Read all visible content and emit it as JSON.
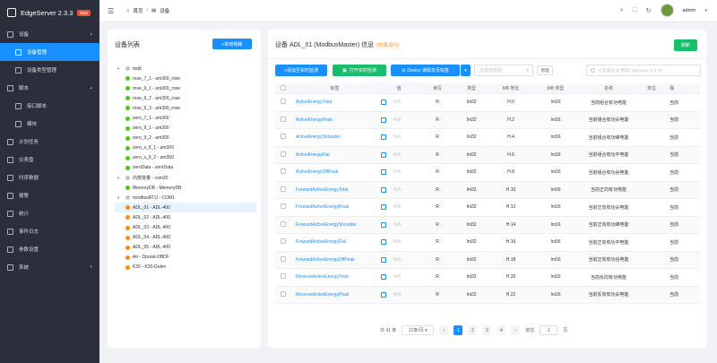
{
  "app": {
    "name": "EdgeServer 2.3.3",
    "badge": "beta"
  },
  "sidebar": {
    "items": [
      {
        "label": "设备",
        "icon": "device-icon",
        "expanded": true
      },
      {
        "label": "设备管理",
        "icon": "device-manage-icon",
        "sub": true,
        "active": true
      },
      {
        "label": "设备类型管理",
        "icon": "device-type-icon",
        "sub": true
      },
      {
        "label": "脚本",
        "icon": "script-icon",
        "expanded": true
      },
      {
        "label": "接口脚本",
        "icon": "interface-script-icon",
        "sub": true
      },
      {
        "label": "模块",
        "icon": "module-icon",
        "sub": true
      },
      {
        "label": "计划任务",
        "icon": "schedule-icon"
      },
      {
        "label": "仪表盘",
        "icon": "dashboard-icon"
      },
      {
        "label": "时序数据",
        "icon": "timeseries-icon"
      },
      {
        "label": "报警",
        "icon": "alarm-icon"
      },
      {
        "label": "统计",
        "icon": "stats-icon"
      },
      {
        "label": "事件日志",
        "icon": "event-log-icon"
      },
      {
        "label": "参数设置",
        "icon": "settings-icon"
      },
      {
        "label": "系统",
        "icon": "system-icon",
        "expandable": true
      }
    ]
  },
  "header": {
    "breadcrumb": [
      "首页",
      "设备"
    ],
    "user": "admin"
  },
  "left_panel": {
    "title": "设备列表",
    "add_button": "+新增链路",
    "tree": [
      {
        "label": "mqtt",
        "level": 0,
        "dot": "gr",
        "caret": "▾"
      },
      {
        "label": "rose_7_1 - am300_rose",
        "level": 1,
        "dot": "g"
      },
      {
        "label": "rose_9_1 - am300_rose",
        "level": 1,
        "dot": "g"
      },
      {
        "label": "rose_9_2 - am300_rose",
        "level": 1,
        "dot": "g"
      },
      {
        "label": "rose_9_3 - am300_rose",
        "level": 1,
        "dot": "g"
      },
      {
        "label": "zero_7_1 - am300",
        "level": 1,
        "dot": "g"
      },
      {
        "label": "zero_9_1 - am300",
        "level": 1,
        "dot": "g"
      },
      {
        "label": "zero_9_2 - am300",
        "level": 1,
        "dot": "g"
      },
      {
        "label": "zero_s_9_1 - am300",
        "level": 1,
        "dot": "g"
      },
      {
        "label": "zero_s_9_2 - am300",
        "level": 1,
        "dot": "g"
      },
      {
        "label": "zeroData - zeroData",
        "level": 1,
        "dot": "g"
      },
      {
        "label": "内部变量 - com20",
        "level": 0,
        "dot": "gr",
        "caret": "▾"
      },
      {
        "label": "MemoryDB - MemoryDB",
        "level": 1,
        "dot": "g"
      },
      {
        "label": "modbusRTU - COM1",
        "level": 0,
        "dot": "gr",
        "caret": "▾"
      },
      {
        "label": "ADL_01 - ADL-400",
        "level": 1,
        "dot": "o",
        "selected": true
      },
      {
        "label": "ADL_02 - ADL-400",
        "level": 1,
        "dot": "o"
      },
      {
        "label": "ADL_03 - ADL-400",
        "level": 1,
        "dot": "o"
      },
      {
        "label": "ADL_04 - ADL-400",
        "level": 1,
        "dot": "o"
      },
      {
        "label": "ADL_05 - ADL-400",
        "level": 1,
        "dot": "o"
      },
      {
        "label": "Air - Dpurat-DBDF",
        "level": 1,
        "dot": "o"
      },
      {
        "label": "K30 - K30-Golen",
        "level": 1,
        "dot": "o"
      }
    ]
  },
  "main": {
    "title": "设备 ADL_01 (ModbusMaster) 信息",
    "status": "(仿真运行)",
    "refresh": "刷新",
    "toolbar": {
      "add_monitor": "+添加至实时监测",
      "open_monitor": "打开实时检测",
      "read_tags": "从 Device 读取本页标签",
      "dropdown": "▾",
      "select_placeholder": "选择标签组",
      "manage": "管理",
      "search_placeholder": "过滤表达式 例如: tagName 0.4-20"
    },
    "columns": [
      "",
      "标签",
      "值",
      "读写",
      "类型",
      "MB 地址",
      "MB 类型",
      "名称",
      "单位",
      "描"
    ],
    "rows": [
      {
        "tag": "ActiveEnergyTotal",
        "value": "N/A",
        "rw": "R",
        "type": "Int32",
        "addr": "H.0",
        "mbtype": "Int16",
        "name": "当前组合有功电能",
        "desc": "当前"
      },
      {
        "tag": "ActiveEnergyPeak",
        "value": "N/A",
        "rw": "R",
        "type": "Int32",
        "addr": "H.2",
        "mbtype": "Int16",
        "name": "当前组合有功尖电能",
        "desc": "当前"
      },
      {
        "tag": "ActiveEnergyShoulder",
        "value": "N/A",
        "rw": "R",
        "type": "Int32",
        "addr": "H.4",
        "mbtype": "Int16",
        "name": "当前组合有功峰电能",
        "desc": "当前"
      },
      {
        "tag": "ActiveEnergyFlat",
        "value": "N/A",
        "rw": "R",
        "type": "Int32",
        "addr": "H.6",
        "mbtype": "Int16",
        "name": "当前组合有功平电能",
        "desc": "当前"
      },
      {
        "tag": "ActiveEnergyOffPeak",
        "value": "N/A",
        "rw": "R",
        "type": "Int32",
        "addr": "H.8",
        "mbtype": "Int16",
        "name": "当前组合有功谷电能",
        "desc": "当前"
      },
      {
        "tag": "ForwardActiveEnergyTotal",
        "value": "N/A",
        "rw": "R",
        "type": "Int32",
        "addr": "H.10",
        "mbtype": "Int16",
        "name": "当前正向有功电能",
        "desc": "当前"
      },
      {
        "tag": "ForwardActiveEnergyPeak",
        "value": "N/A",
        "rw": "R",
        "type": "Int32",
        "addr": "H.12",
        "mbtype": "Int16",
        "name": "当前正向有功尖电能",
        "desc": "当前"
      },
      {
        "tag": "ForwardActiveEnergyShoulder",
        "value": "N/A",
        "rw": "R",
        "type": "Int32",
        "addr": "H.14",
        "mbtype": "Int16",
        "name": "当前正向有功峰电能",
        "desc": "当前"
      },
      {
        "tag": "ForwardActiveEnergyFlat",
        "value": "N/A",
        "rw": "R",
        "type": "Int32",
        "addr": "H.16",
        "mbtype": "Int16",
        "name": "当前正向有功平电能",
        "desc": "当前"
      },
      {
        "tag": "ForwardActiveEnergyOffPeak",
        "value": "N/A",
        "rw": "R",
        "type": "Int32",
        "addr": "H.18",
        "mbtype": "Int16",
        "name": "当前正向有功谷电能",
        "desc": "当前"
      },
      {
        "tag": "ReverseActiveEnergyTotal",
        "value": "N/A",
        "rw": "R",
        "type": "Int32",
        "addr": "H.20",
        "mbtype": "Int16",
        "name": "当前反向有功电能",
        "desc": "当前"
      },
      {
        "tag": "ReverseActiveEnergyPeak",
        "value": "N/A",
        "rw": "R",
        "type": "Int32",
        "addr": "H.22",
        "mbtype": "Int16",
        "name": "当前反向有功尖电能",
        "desc": "当前"
      }
    ],
    "pager": {
      "total": "共 41 条",
      "size": "12条/页",
      "pages": [
        "1",
        "2",
        "3",
        "4"
      ],
      "current": "1",
      "prev": "‹",
      "next": "›",
      "goto": "前往",
      "goto_value": "1",
      "page_unit": "页"
    }
  }
}
